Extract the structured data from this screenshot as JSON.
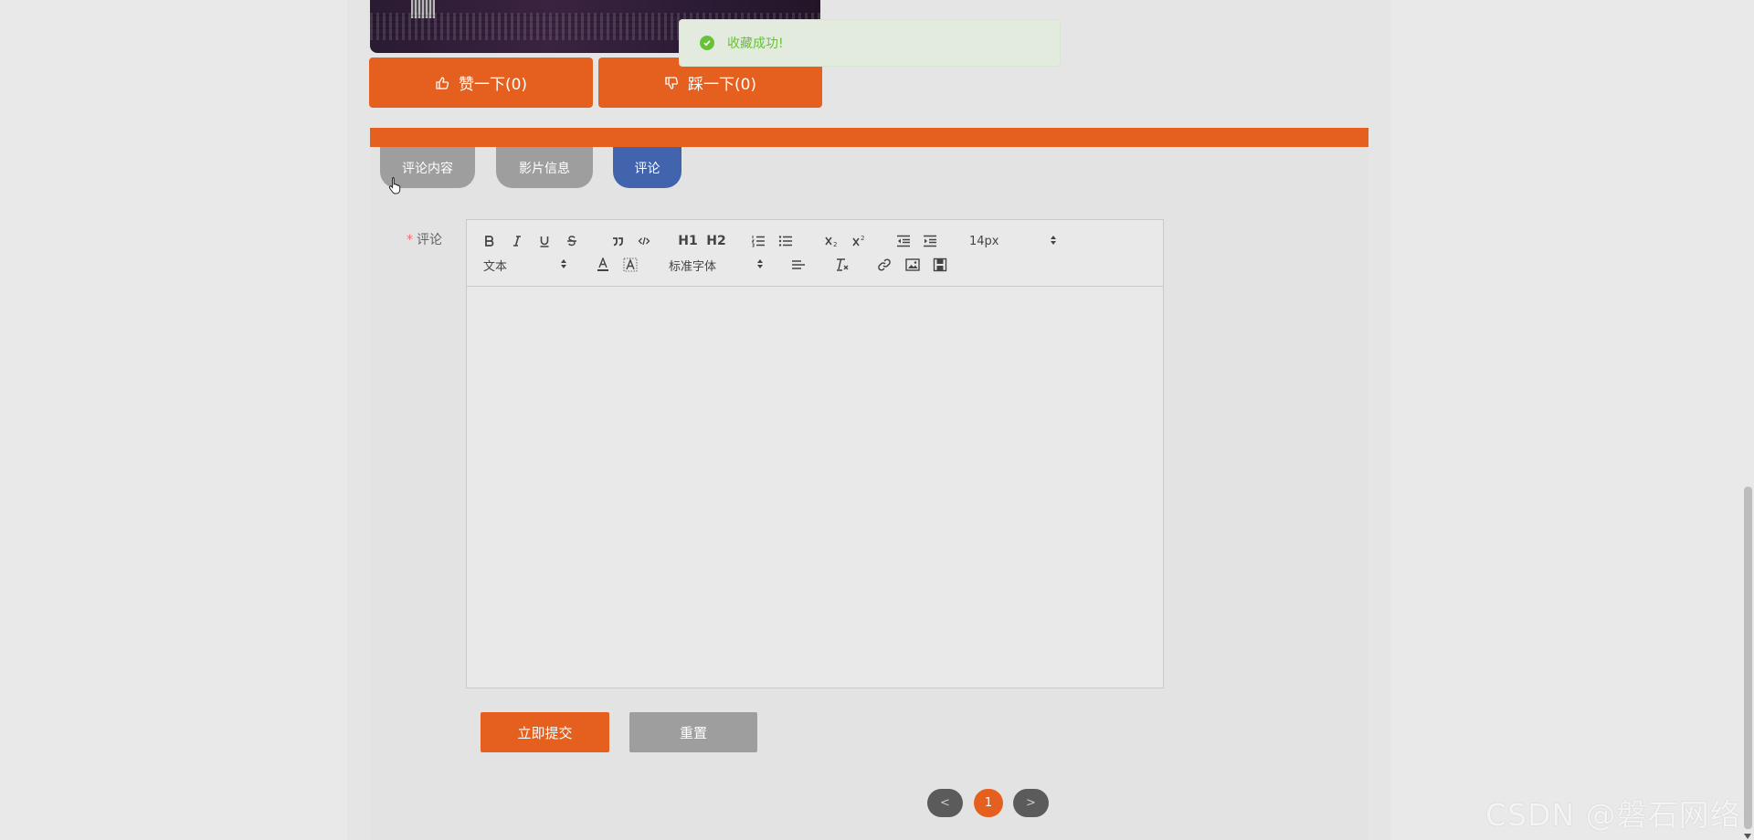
{
  "vote": {
    "like_label": "赞一下(0)",
    "dislike_label": "踩一下(0)"
  },
  "toast": {
    "message": "收藏成功!",
    "type": "success"
  },
  "tabs": [
    {
      "label": "评论内容",
      "active": false
    },
    {
      "label": "影片信息",
      "active": false
    },
    {
      "label": "评论",
      "active": true
    }
  ],
  "form": {
    "comment_label": "评论",
    "required_mark": "*",
    "toolbar": {
      "font_size": "14px",
      "header_format": "文本",
      "font_family": "标准字体",
      "h1": "H1",
      "h2": "H2"
    },
    "submit_label": "立即提交",
    "reset_label": "重置"
  },
  "pagination": {
    "prev": "<",
    "current": "1",
    "next": ">"
  },
  "watermark": "CSDN @磐石网络",
  "colors": {
    "accent": "#e5601f",
    "active_tab": "#4164ad",
    "inactive_tab": "#9e9e9e",
    "success": "#67c23a"
  }
}
